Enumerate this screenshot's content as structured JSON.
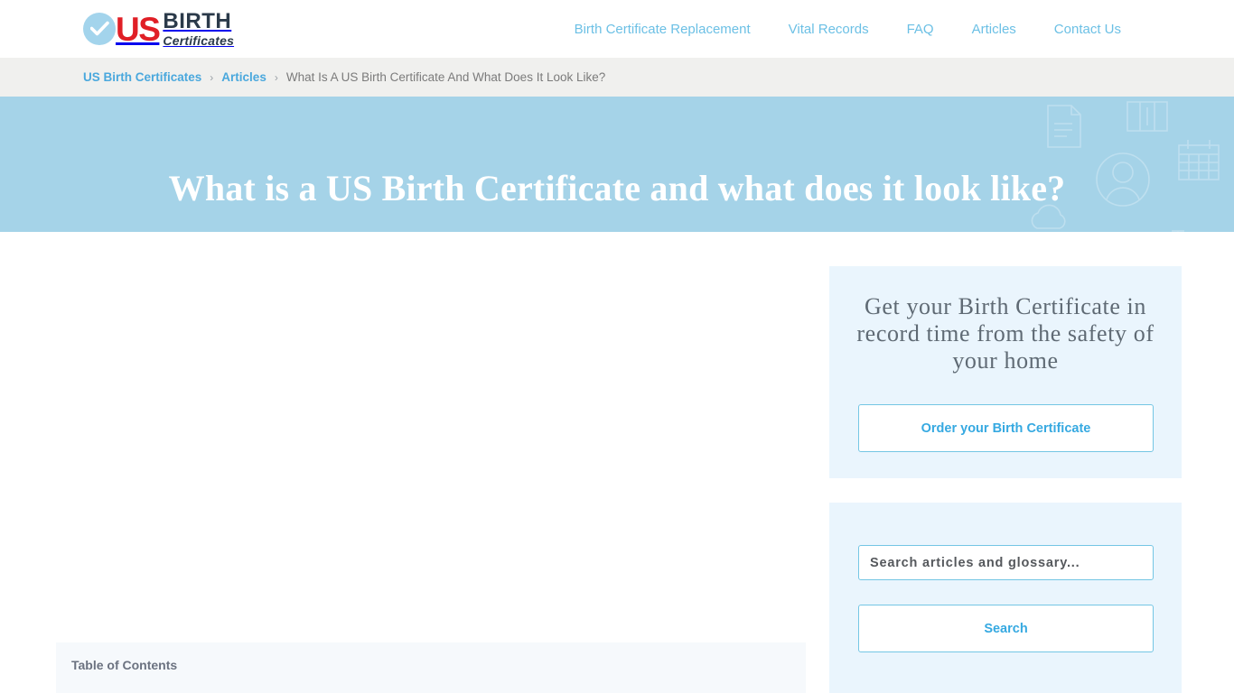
{
  "header": {
    "logo": {
      "check_icon": "check-circle-icon",
      "us": "US",
      "birth": "BIRTH",
      "certificates": "Certificates"
    },
    "nav": [
      {
        "label": "Birth Certificate Replacement"
      },
      {
        "label": "Vital Records"
      },
      {
        "label": "FAQ"
      },
      {
        "label": "Articles"
      },
      {
        "label": "Contact Us"
      }
    ]
  },
  "breadcrumb": {
    "items": [
      {
        "label": "US Birth Certificates",
        "link": true
      },
      {
        "label": "Articles",
        "link": true
      },
      {
        "label": "What Is A US Birth Certificate And What Does It Look Like?",
        "link": false
      }
    ],
    "separator": "›"
  },
  "hero": {
    "title": "What is a US Birth Certificate and what does it look like?",
    "background_color": "#a5d3e8",
    "decorative_icons": [
      "document-icon",
      "building-icon",
      "calendar-icon",
      "person-avatar-icon",
      "question-mark-icon",
      "cloud-icon",
      "stopwatch-icon",
      "document-lines-icon"
    ]
  },
  "content": {
    "table_of_contents": {
      "title": "Table of Contents"
    }
  },
  "sidebar": {
    "cta": {
      "heading": "Get your Birth Certificate in record time from the safety of your home",
      "button_label": "Order your Birth Certificate"
    },
    "search": {
      "placeholder": "Search articles and glossary...",
      "value": "",
      "button_label": "Search"
    }
  },
  "colors": {
    "accent_blue": "#36a9e1",
    "nav_blue": "#6cc0e5",
    "hero_blue": "#a5d3e8",
    "card_blue": "#eaf5fd",
    "logo_red": "#e01f26",
    "logo_navy": "#2b3a4a",
    "breadcrumb_bg": "#f0f0ee",
    "toc_bg": "#f6f9fc"
  }
}
